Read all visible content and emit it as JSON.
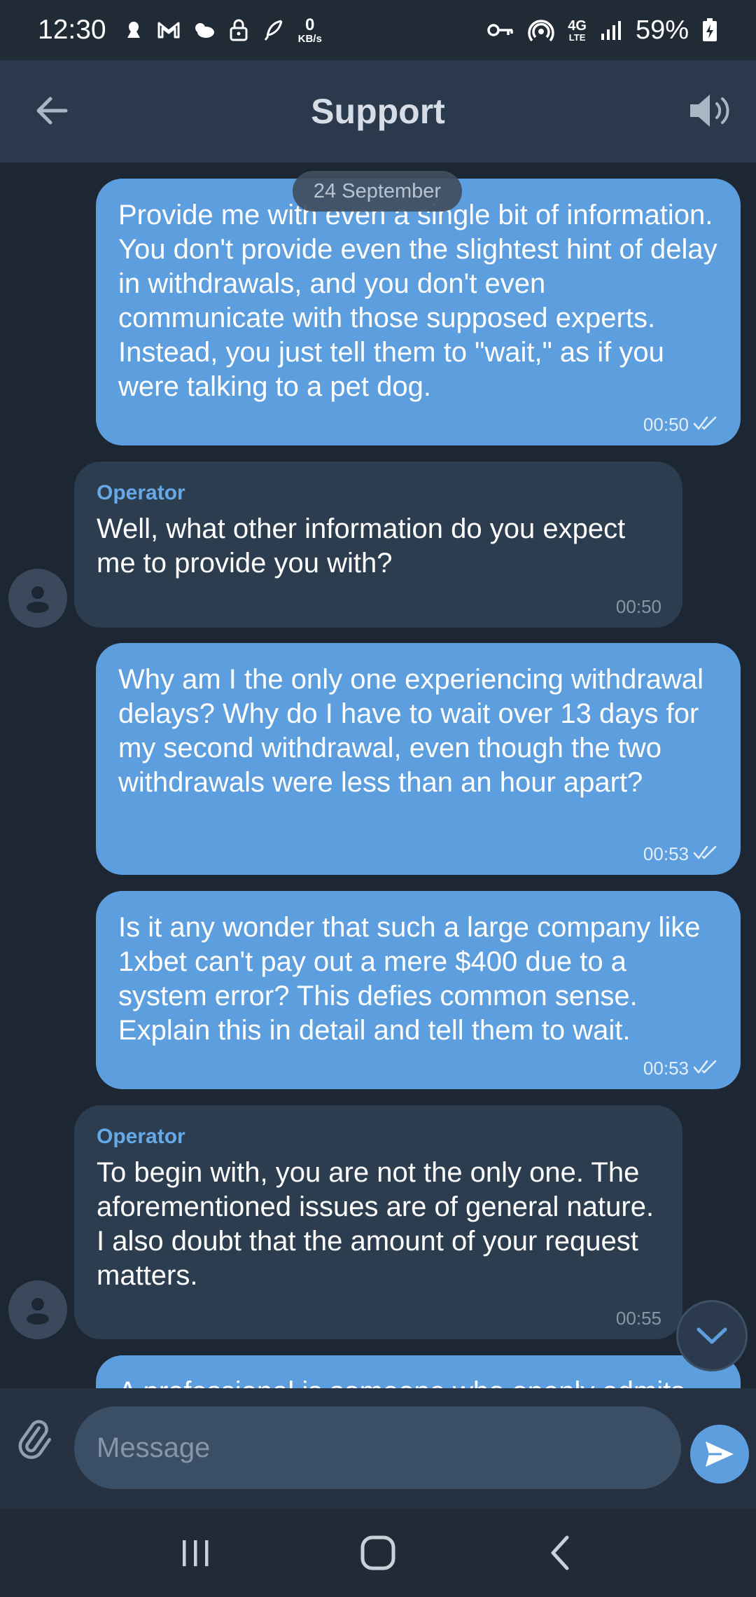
{
  "status_bar": {
    "time": "12:30",
    "speed_value": "0",
    "speed_unit": "KB/s",
    "network": "4G",
    "network_sub": "LTE",
    "battery": "59%"
  },
  "header": {
    "title": "Support",
    "back_icon": "arrow-left-icon",
    "speaker_icon": "speaker-icon"
  },
  "chat": {
    "date_label": "24 September",
    "messages": [
      {
        "direction": "out",
        "text": "Provide me with even a single bit of information. You don't provide even the slightest hint of delay in withdrawals, and you don't even communicate with those supposed experts. Instead, you just tell them to \"wait,\" as if you were talking to a pet dog.",
        "time": "00:50"
      },
      {
        "direction": "in",
        "sender": "Operator",
        "text": "Well, what other information do you expect me to provide you with?",
        "time": "00:50"
      },
      {
        "direction": "out",
        "text": "Why am I the only one experiencing withdrawal delays? Why do I have to wait over 13 days for my second withdrawal, even though the two withdrawals were less than an hour apart?",
        "time": "00:53"
      },
      {
        "direction": "out",
        "text": "Is it any wonder that such a large company like 1xbet can't pay out a mere $400 due to a system error? This defies common sense. Explain this in detail and tell them to wait.",
        "time": "00:53"
      },
      {
        "direction": "in",
        "sender": "Operator",
        "text": "To begin with, you are not the only one. The aforementioned issues are of general nature. I also doubt that the amount of your request matters.",
        "time": "00:55"
      },
      {
        "direction": "out",
        "text": "A professional is someone who openly admits",
        "time": ""
      }
    ]
  },
  "composer": {
    "placeholder": "Message",
    "attach_icon": "paperclip-icon",
    "send_icon": "send-icon"
  },
  "colors": {
    "background": "#1d2733",
    "header": "#2a3a4c",
    "outgoing_bubble": "#5c9ede",
    "incoming_bubble": "#2c3d50",
    "sender_name": "#66a9e9"
  }
}
